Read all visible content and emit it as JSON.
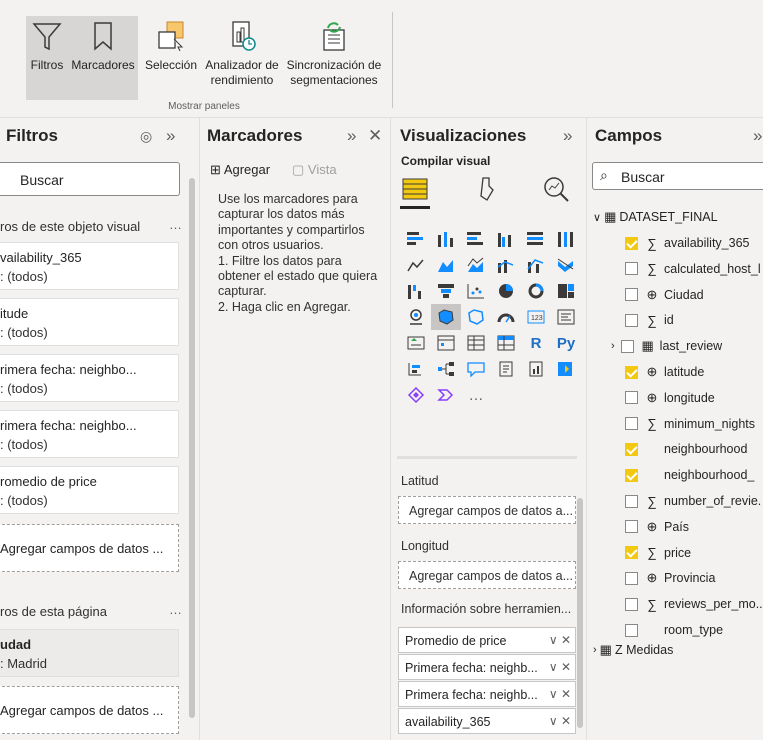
{
  "ribbon": {
    "buttons": [
      {
        "label": "Filtros",
        "icon": "filter-icon"
      },
      {
        "label": "Marcadores",
        "icon": "bookmark-icon"
      },
      {
        "label": "Selección",
        "icon": "selection-icon"
      },
      {
        "label": "Analizador de rendimiento",
        "icon": "performance-analyzer-icon"
      },
      {
        "label": "Sincronización de segmentaciones",
        "icon": "sync-slicers-icon"
      }
    ],
    "group_label": "Mostrar paneles"
  },
  "filtros": {
    "title": "Filtros",
    "search_placeholder": "Buscar",
    "visual_section": "ros de este objeto visual",
    "visual_cards": [
      {
        "name": "vailability_365",
        "value": ": (todos)"
      },
      {
        "name": "itude",
        "value": ": (todos)"
      },
      {
        "name": "rimera fecha: neighbo...",
        "value": ": (todos)"
      },
      {
        "name": "rimera fecha: neighbo...",
        "value": ": (todos)"
      },
      {
        "name": "romedio de price",
        "value": ": (todos)"
      }
    ],
    "add_fields": "Agregar campos de datos ...",
    "page_section": "ros de esta página",
    "page_cards": [
      {
        "name": "udad",
        "value": ": Madrid"
      }
    ],
    "add_fields_page": "Agregar campos de datos ..."
  },
  "marcadores": {
    "title": "Marcadores",
    "add_label": "Agregar",
    "view_label": "Vista",
    "help_text": "Use los marcadores para capturar los datos más importantes y compartirlos con otros usuarios.\n1. Filtre los datos para obtener el estado que quiera capturar.\n2. Haga clic en Agregar."
  },
  "visualizaciones": {
    "title": "Visualizaciones",
    "compile_label": "Compilar visual",
    "wells": [
      {
        "label": "Latitud",
        "placeholder": "Agregar campos de datos a..."
      },
      {
        "label": "Longitud",
        "placeholder": "Agregar campos de datos a..."
      }
    ],
    "tooltip_label": "Información sobre herramien...",
    "tooltip_fields": [
      "Promedio de price",
      "Primera fecha: neighb...",
      "Primera fecha: neighb...",
      "availability_365"
    ]
  },
  "campos": {
    "title": "Campos",
    "search_placeholder": "Buscar",
    "dataset": "DATASET_FINAL",
    "fields": [
      {
        "name": "availability_365",
        "checked": true,
        "type": "sum"
      },
      {
        "name": "calculated_host_l",
        "checked": false,
        "type": "sum"
      },
      {
        "name": "Ciudad",
        "checked": false,
        "type": "globe"
      },
      {
        "name": "id",
        "checked": false,
        "type": "sum"
      },
      {
        "name": "last_review",
        "checked": false,
        "type": "calendar"
      },
      {
        "name": "latitude",
        "checked": true,
        "type": "globe"
      },
      {
        "name": "longitude",
        "checked": false,
        "type": "globe"
      },
      {
        "name": "minimum_nights",
        "checked": false,
        "type": "sum"
      },
      {
        "name": "neighbourhood",
        "checked": true,
        "type": "none"
      },
      {
        "name": "neighbourhood_",
        "checked": true,
        "type": "none"
      },
      {
        "name": "number_of_revie.",
        "checked": false,
        "type": "sum"
      },
      {
        "name": "País",
        "checked": false,
        "type": "globe"
      },
      {
        "name": "price",
        "checked": true,
        "type": "sum"
      },
      {
        "name": "Provincia",
        "checked": false,
        "type": "globe"
      },
      {
        "name": "reviews_per_mo..",
        "checked": false,
        "type": "sum"
      },
      {
        "name": "room_type",
        "checked": false,
        "type": "none"
      }
    ],
    "measures_table": "Z Medidas"
  }
}
